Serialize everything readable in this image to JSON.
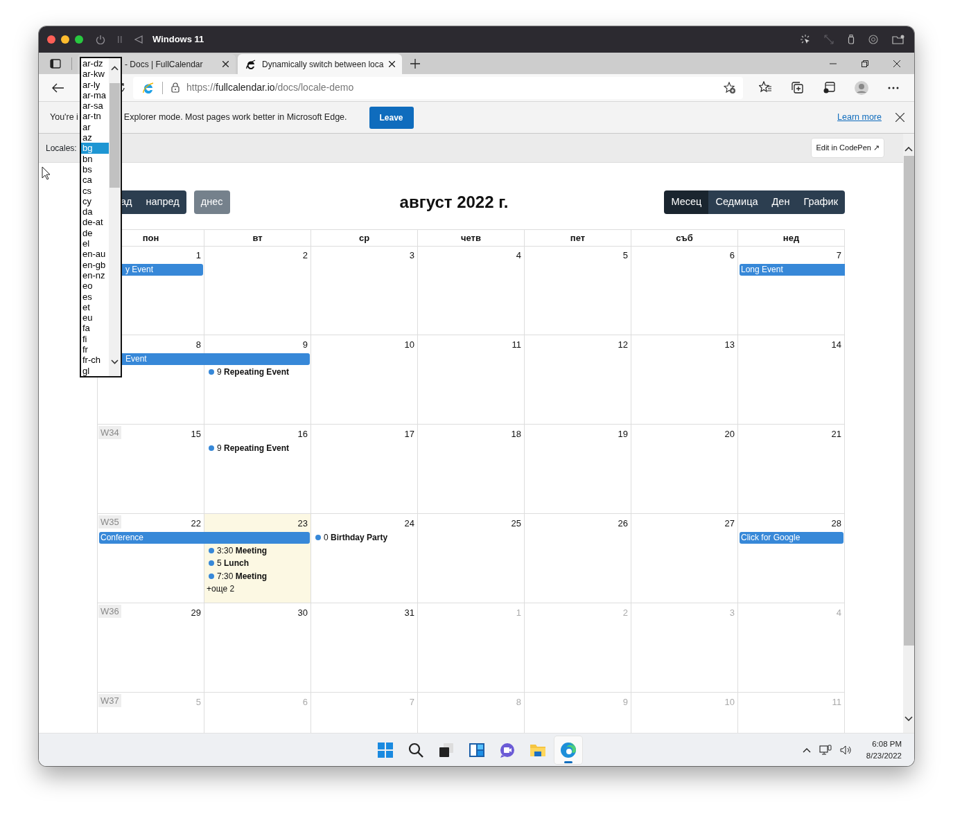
{
  "mac_titlebar": {
    "title": "Windows 11"
  },
  "tabs": [
    {
      "title": "- Docs | FullCalendar",
      "selected": false
    },
    {
      "title": "Dynamically switch between loca",
      "selected": true
    }
  ],
  "address_bar": {
    "scheme": "https://",
    "host": "fullcalendar.io",
    "path": "/docs/locale-demo"
  },
  "ie_mode_bar": {
    "text_before": "You're i",
    "text_after": "Explorer mode. Most pages work better in Microsoft Edge.",
    "button": "Leave",
    "link": "Learn more"
  },
  "locales_bar": {
    "label": "Locales:",
    "codepen_button": "Edit in CodePen ↗"
  },
  "locale_dropdown": {
    "options": [
      {
        "label": "ar-dz",
        "selected": false
      },
      {
        "label": "ar-kw",
        "selected": false
      },
      {
        "label": "ar-ly",
        "selected": false
      },
      {
        "label": "ar-ma",
        "selected": false
      },
      {
        "label": "ar-sa",
        "selected": false
      },
      {
        "label": "ar-tn",
        "selected": false
      },
      {
        "label": "ar",
        "selected": false
      },
      {
        "label": "az",
        "selected": false
      },
      {
        "label": "bg",
        "selected": true
      },
      {
        "label": "bn",
        "selected": false
      },
      {
        "label": "bs",
        "selected": false
      },
      {
        "label": "ca",
        "selected": false
      },
      {
        "label": "cs",
        "selected": false
      },
      {
        "label": "cy",
        "selected": false
      },
      {
        "label": "da",
        "selected": false
      },
      {
        "label": "de-at",
        "selected": false
      },
      {
        "label": "de",
        "selected": false
      },
      {
        "label": "el",
        "selected": false
      },
      {
        "label": "en-au",
        "selected": false
      },
      {
        "label": "en-gb",
        "selected": false
      },
      {
        "label": "en-nz",
        "selected": false
      },
      {
        "label": "eo",
        "selected": false
      },
      {
        "label": "es",
        "selected": false
      },
      {
        "label": "et",
        "selected": false
      },
      {
        "label": "eu",
        "selected": false
      },
      {
        "label": "fa",
        "selected": false
      },
      {
        "label": "fi",
        "selected": false
      },
      {
        "label": "fr",
        "selected": false
      },
      {
        "label": "fr-ch",
        "selected": false
      },
      {
        "label": "gl",
        "selected": false
      }
    ]
  },
  "calendar": {
    "prev_button": "ад",
    "next_button": "напред",
    "today_button": {
      "label": "днес",
      "disabled": true
    },
    "title": "август 2022 г.",
    "views": [
      {
        "label": "Месец",
        "selected": true
      },
      {
        "label": "Седмица",
        "selected": false
      },
      {
        "label": "Ден",
        "selected": false
      },
      {
        "label": "График",
        "selected": false
      }
    ],
    "weekdays": [
      "пон",
      "вт",
      "ср",
      "четв",
      "пет",
      "съб",
      "нед"
    ],
    "weeks": [
      {
        "days": [
          {
            "day": "1",
            "other_month": false,
            "today": false,
            "events": [
              {
                "kind": "bar",
                "title": "y Event",
                "two_days": false,
                "continues": false,
                "clipped_left": true
              }
            ]
          },
          {
            "day": "2",
            "other_month": false,
            "today": false
          },
          {
            "day": "3",
            "other_month": false,
            "today": false
          },
          {
            "day": "4",
            "other_month": false,
            "today": false
          },
          {
            "day": "5",
            "other_month": false,
            "today": false
          },
          {
            "day": "6",
            "other_month": false,
            "today": false
          },
          {
            "day": "7",
            "other_month": false,
            "today": false,
            "events": [
              {
                "kind": "bar",
                "title": "Long Event",
                "continues": true,
                "clipped_left": false
              }
            ]
          }
        ]
      },
      {
        "days": [
          {
            "day": "8",
            "other_month": false,
            "today": false,
            "events": [
              {
                "kind": "bar",
                "title": "Event",
                "two_days": true,
                "continues": false,
                "clipped_left": true
              }
            ]
          },
          {
            "day": "9",
            "other_month": false,
            "today": false,
            "events": [
              {
                "kind": "dot",
                "time": "9",
                "title": "Repeating Event"
              }
            ]
          },
          {
            "day": "10",
            "other_month": false,
            "today": false
          },
          {
            "day": "11",
            "other_month": false,
            "today": false
          },
          {
            "day": "12",
            "other_month": false,
            "today": false
          },
          {
            "day": "13",
            "other_month": false,
            "today": false
          },
          {
            "day": "14",
            "other_month": false,
            "today": false
          }
        ]
      },
      {
        "week_number": "W34",
        "days": [
          {
            "day": "15",
            "other_month": false,
            "today": false
          },
          {
            "day": "16",
            "other_month": false,
            "today": false,
            "events": [
              {
                "kind": "dot",
                "time": "9",
                "title": "Repeating Event"
              }
            ]
          },
          {
            "day": "17",
            "other_month": false,
            "today": false
          },
          {
            "day": "18",
            "other_month": false,
            "today": false
          },
          {
            "day": "19",
            "other_month": false,
            "today": false
          },
          {
            "day": "20",
            "other_month": false,
            "today": false
          },
          {
            "day": "21",
            "other_month": false,
            "today": false
          }
        ]
      },
      {
        "week_number": "W35",
        "days": [
          {
            "day": "22",
            "other_month": false,
            "today": false,
            "events": [
              {
                "kind": "bar",
                "title": "Conference",
                "two_days": true,
                "continues": false,
                "clipped_left": false
              }
            ]
          },
          {
            "day": "23",
            "other_month": false,
            "today": true,
            "events": [
              {
                "kind": "dot",
                "time": "3:30",
                "title": "Meeting"
              },
              {
                "kind": "dot",
                "time": "5",
                "title": "Lunch"
              },
              {
                "kind": "dot",
                "time": "7:30",
                "title": "Meeting"
              },
              {
                "kind": "more",
                "title": "+още 2"
              }
            ]
          },
          {
            "day": "24",
            "other_month": false,
            "today": false,
            "events": [
              {
                "kind": "dot",
                "time": "0",
                "title": "Birthday Party"
              }
            ]
          },
          {
            "day": "25",
            "other_month": false,
            "today": false
          },
          {
            "day": "26",
            "other_month": false,
            "today": false
          },
          {
            "day": "27",
            "other_month": false,
            "today": false
          },
          {
            "day": "28",
            "other_month": false,
            "today": false,
            "events": [
              {
                "kind": "bar",
                "title": "Click for Google",
                "continues": false,
                "clipped_left": false
              }
            ]
          }
        ]
      },
      {
        "week_number": "W36",
        "days": [
          {
            "day": "29",
            "other_month": false,
            "today": false
          },
          {
            "day": "30",
            "other_month": false,
            "today": false
          },
          {
            "day": "31",
            "other_month": false,
            "today": false
          },
          {
            "day": "1",
            "other_month": true,
            "today": false
          },
          {
            "day": "2",
            "other_month": true,
            "today": false
          },
          {
            "day": "3",
            "other_month": true,
            "today": false
          },
          {
            "day": "4",
            "other_month": true,
            "today": false
          }
        ]
      },
      {
        "week_number": "W37",
        "days": [
          {
            "day": "5",
            "other_month": true,
            "today": false
          },
          {
            "day": "6",
            "other_month": true,
            "today": false
          },
          {
            "day": "7",
            "other_month": true,
            "today": false
          },
          {
            "day": "8",
            "other_month": true,
            "today": false
          },
          {
            "day": "9",
            "other_month": true,
            "today": false
          },
          {
            "day": "10",
            "other_month": true,
            "today": false
          },
          {
            "day": "11",
            "other_month": true,
            "today": false
          }
        ]
      }
    ]
  },
  "taskbar": {
    "apps": [
      {
        "kind": "start",
        "active": false
      },
      {
        "kind": "search",
        "active": false
      },
      {
        "kind": "taskview",
        "active": false
      },
      {
        "kind": "widgets",
        "active": false
      },
      {
        "kind": "chat",
        "active": false
      },
      {
        "kind": "explorer",
        "active": false
      },
      {
        "kind": "edge",
        "active": true
      }
    ],
    "time": "6:08 PM",
    "date": "8/23/2022"
  }
}
